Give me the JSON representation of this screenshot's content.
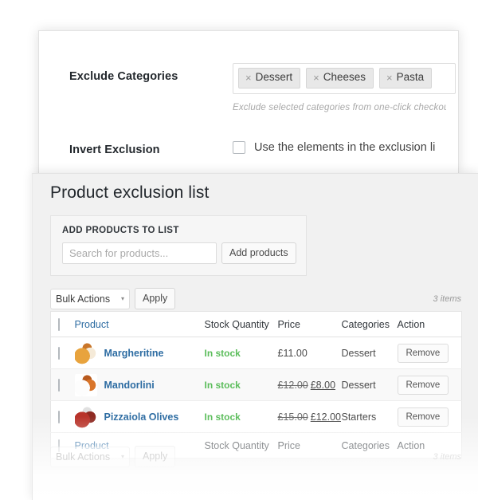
{
  "settings": {
    "rows": [
      {
        "label": "Exclude Categories",
        "chips": [
          "Dessert",
          "Cheeses",
          "Pasta"
        ],
        "remove_glyph": "×",
        "help": "Exclude selected categories from one-click checkout fea"
      },
      {
        "label": "Invert Exclusion",
        "checkbox_label": "Use the elements in the exclusion li",
        "checked": false
      }
    ]
  },
  "list": {
    "title": "Product exclusion list",
    "add_box": {
      "heading": "ADD PRODUCTS TO LIST",
      "search_placeholder": "Search for products...",
      "search_value": "",
      "add_button": "Add products"
    },
    "tablenav_top": {
      "bulk_label": "Bulk Actions",
      "caret": "▾",
      "apply_label": "Apply",
      "items_count": "3 items"
    },
    "tablenav_bottom": {
      "bulk_label": "Bulk Actions",
      "caret": "▾",
      "apply_label": "Apply",
      "items_count": "3 items"
    },
    "table": {
      "columns": [
        "Product",
        "Stock Quantity",
        "Price",
        "Categories",
        "Action"
      ],
      "rows": [
        {
          "name": "Margheritine",
          "stock": "In stock",
          "price": "£11.00",
          "price_old": "",
          "price_new": "",
          "category": "Dessert",
          "action": "Remove",
          "thumb_colors": [
            "#e8a33d",
            "#f5ead8",
            "#c9762a"
          ]
        },
        {
          "name": "Mandorlini",
          "stock": "In stock",
          "price": "",
          "price_old": "£12.00",
          "price_new": "£8.00",
          "category": "Dessert",
          "action": "Remove",
          "thumb_colors": [
            "#fdfdfd",
            "#d9752a",
            "#b85a1e"
          ]
        },
        {
          "name": "Pizzaiola Olives",
          "stock": "In stock",
          "price": "",
          "price_old": "£15.00",
          "price_new": "£12.00",
          "category": "Starters",
          "action": "Remove",
          "thumb_colors": [
            "#b8332a",
            "#8e2a22",
            "#e0e0e0"
          ]
        }
      ]
    }
  },
  "colors": {
    "link": "#2d6ca2",
    "in_stock": "#5bbd5b",
    "panel_bg": "#f1f1f1",
    "heading": "#23282d"
  }
}
